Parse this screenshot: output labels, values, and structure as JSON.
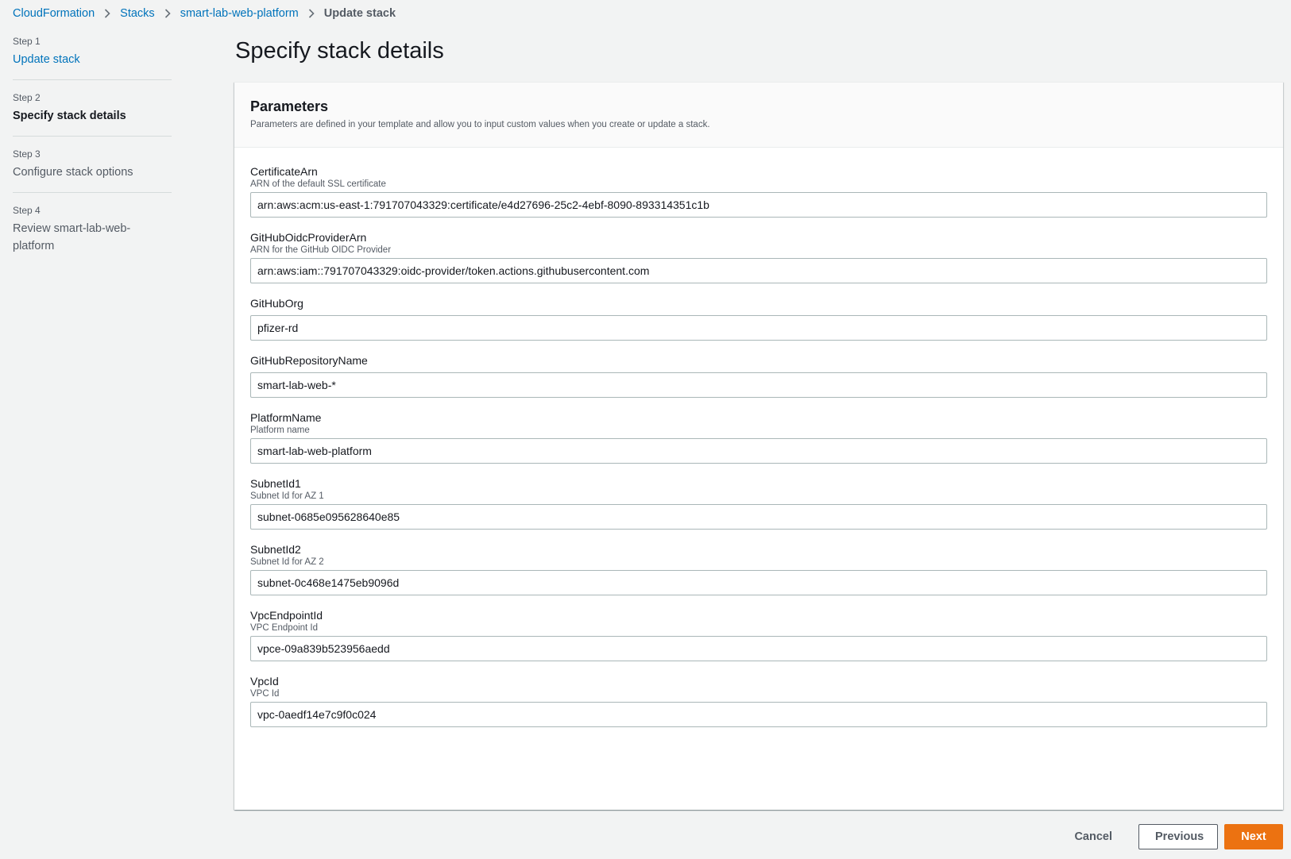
{
  "breadcrumb": {
    "items": [
      "CloudFormation",
      "Stacks",
      "smart-lab-web-platform"
    ],
    "current": "Update stack"
  },
  "steps": [
    {
      "num": "Step 1",
      "label": "Update stack"
    },
    {
      "num": "Step 2",
      "label": "Specify stack details"
    },
    {
      "num": "Step 3",
      "label": "Configure stack options"
    },
    {
      "num": "Step 4",
      "label": "Review smart-lab-web-platform"
    }
  ],
  "page_title": "Specify stack details",
  "parameters": {
    "title": "Parameters",
    "description": "Parameters are defined in your template and allow you to input custom values when you create or update a stack.",
    "fields": [
      {
        "label": "CertificateArn",
        "hint": "ARN of the default SSL certificate",
        "value": "arn:aws:acm:us-east-1:791707043329:certificate/e4d27696-25c2-4ebf-8090-893314351c1b"
      },
      {
        "label": "GitHubOidcProviderArn",
        "hint": "ARN for the GitHub OIDC Provider",
        "value": "arn:aws:iam::791707043329:oidc-provider/token.actions.githubusercontent.com"
      },
      {
        "label": "GitHubOrg",
        "hint": "",
        "value": "pfizer-rd"
      },
      {
        "label": "GitHubRepositoryName",
        "hint": "",
        "value": "smart-lab-web-*"
      },
      {
        "label": "PlatformName",
        "hint": "Platform name",
        "value": "smart-lab-web-platform"
      },
      {
        "label": "SubnetId1",
        "hint": "Subnet Id for AZ 1",
        "value": "subnet-0685e095628640e85"
      },
      {
        "label": "SubnetId2",
        "hint": "Subnet Id for AZ 2",
        "value": "subnet-0c468e1475eb9096d"
      },
      {
        "label": "VpcEndpointId",
        "hint": "VPC Endpoint Id",
        "value": "vpce-09a839b523956aedd"
      },
      {
        "label": "VpcId",
        "hint": "VPC Id",
        "value": "vpc-0aedf14e7c9f0c024"
      }
    ]
  },
  "actions": {
    "cancel": "Cancel",
    "previous": "Previous",
    "next": "Next"
  },
  "colors": {
    "link": "#0073bb",
    "primary": "#ec7211",
    "background": "#f2f3f3"
  }
}
